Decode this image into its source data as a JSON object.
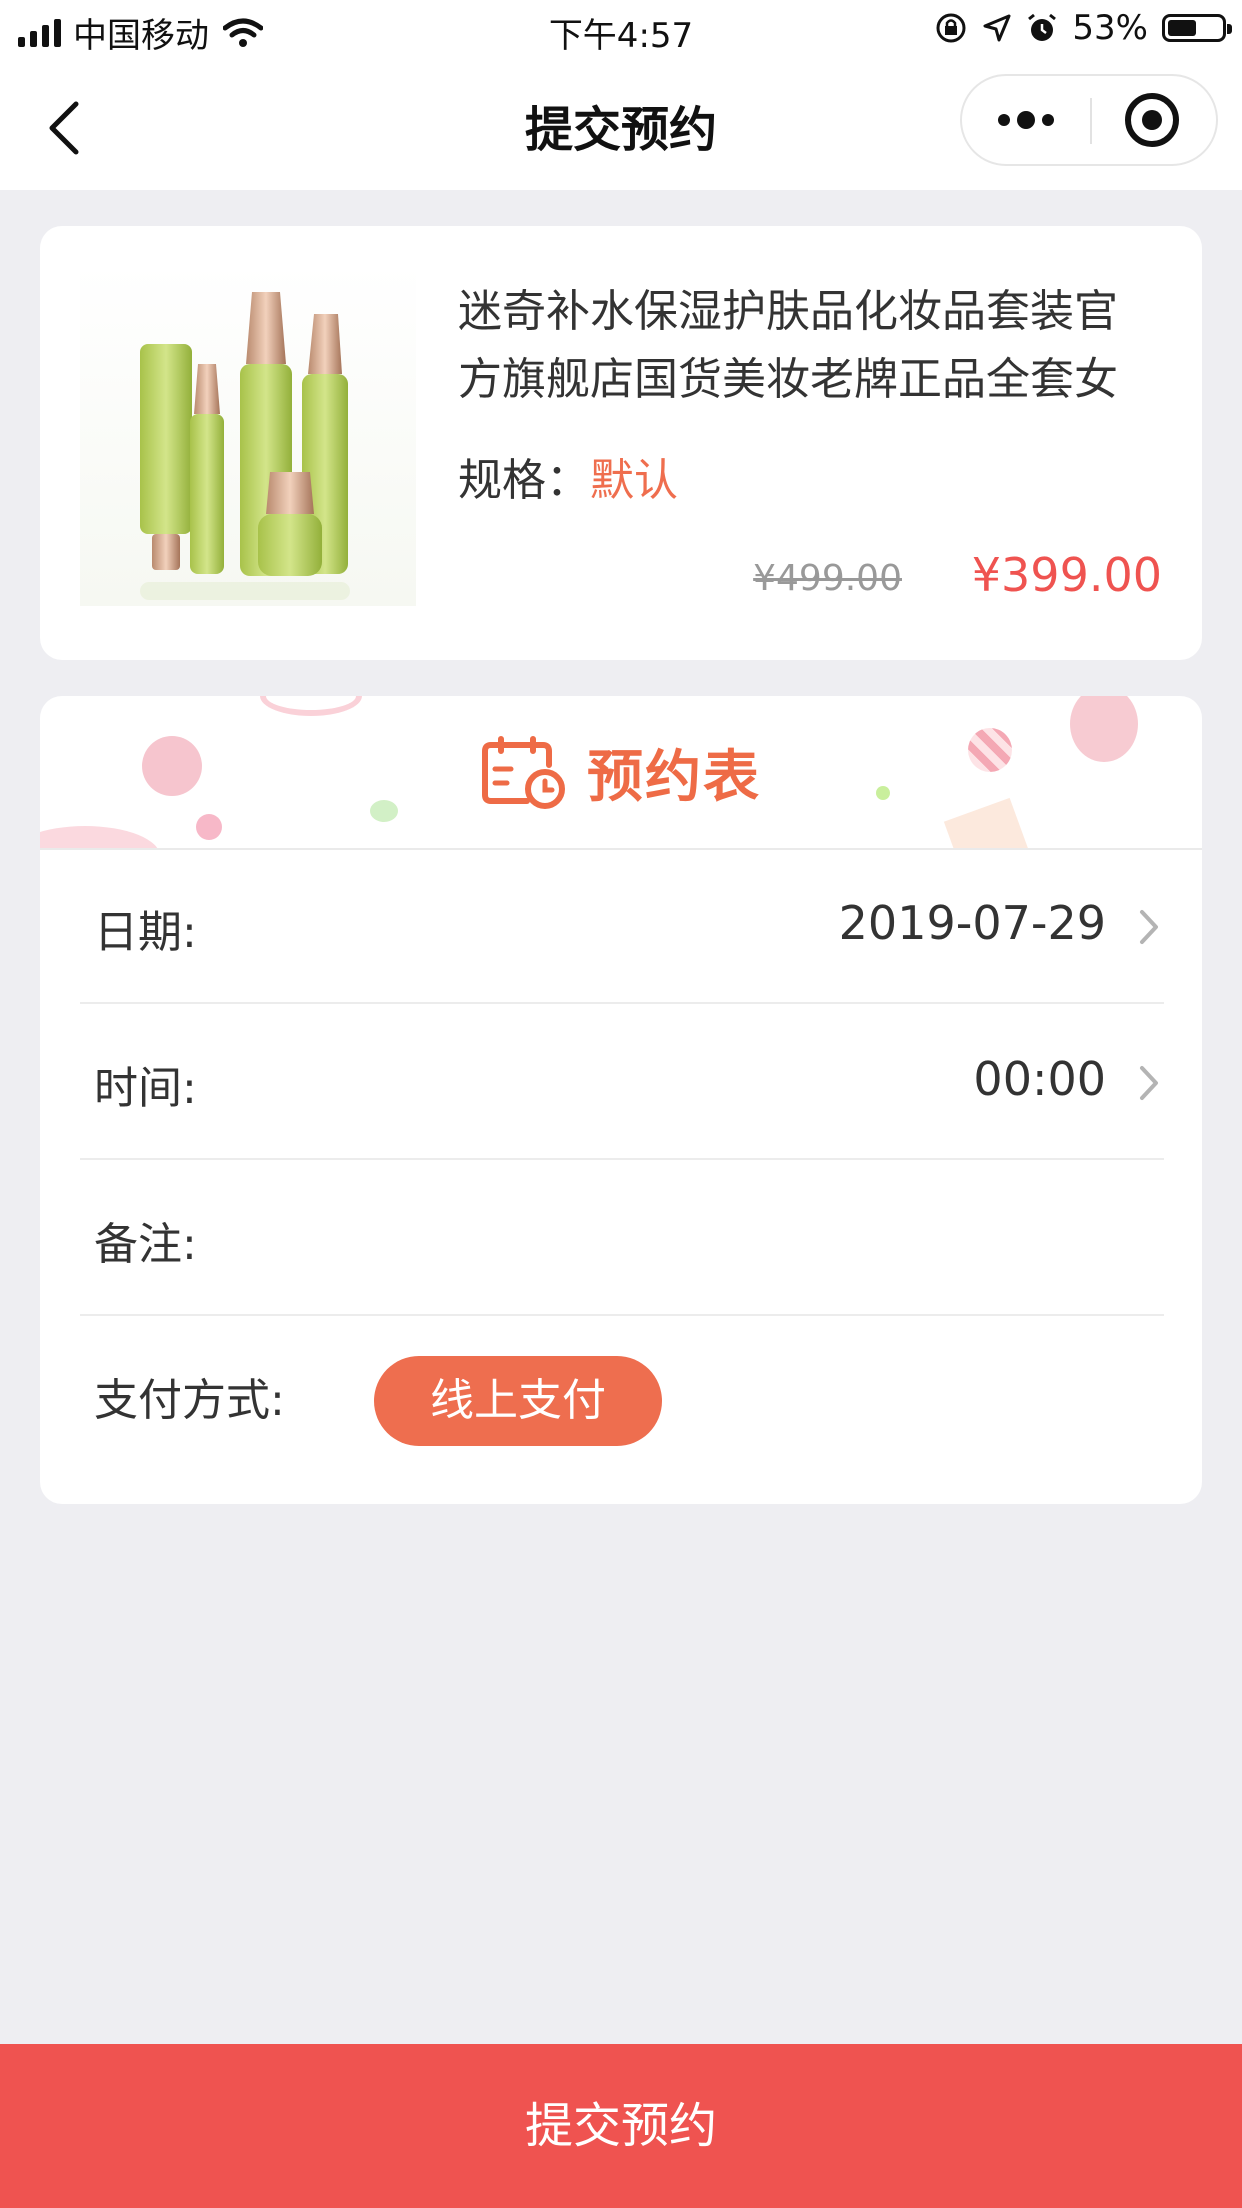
{
  "status_bar": {
    "carrier": "中国移动",
    "time": "下午4:57",
    "battery": "53%",
    "battery_level": 0.53
  },
  "nav": {
    "title": "提交预约",
    "back_icon": "chevron-left-icon",
    "more_icon": "more-dots-icon",
    "close_icon": "target-circle-icon"
  },
  "product": {
    "title": " 迷奇补水保湿护肤品化妆品套装官方旗舰店国货美妆老牌正品全套女",
    "spec_label": "规格：",
    "spec_value": "默认",
    "original_price": "¥499.00",
    "price": "¥399.00"
  },
  "form": {
    "banner_title": "预约表",
    "date_label": "日期:",
    "date_value": "2019-07-29",
    "time_label": "时间:",
    "time_value": "00:00",
    "remark_label": "备注:",
    "payment_label": "支付方式:",
    "payment_option": "线上支付"
  },
  "submit": {
    "label": "提交预约"
  },
  "colors": {
    "accent": "#ef5350",
    "chip": "#ee6e4f",
    "spec": "#ef6e4e"
  }
}
